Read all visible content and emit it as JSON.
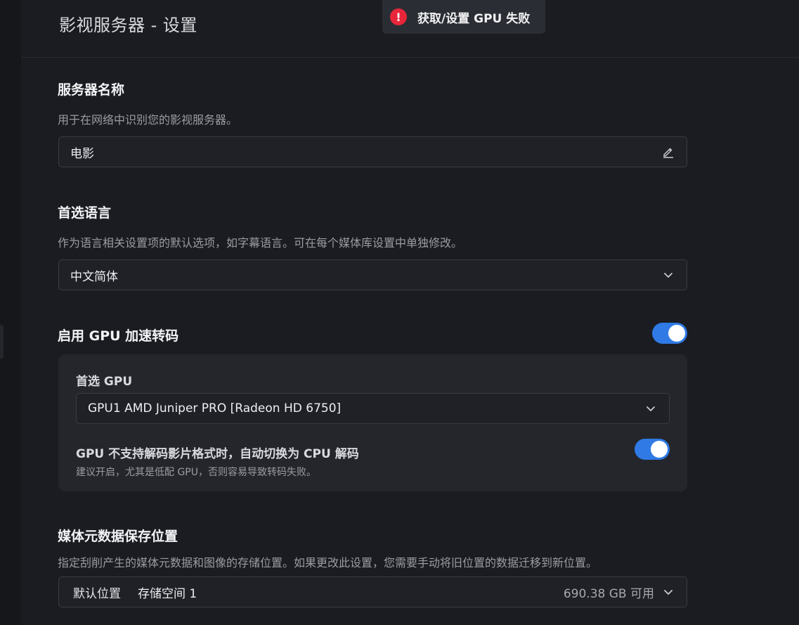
{
  "header": {
    "title": "影视服务器 - 设置"
  },
  "toast": {
    "icon": "error-icon",
    "icon_glyph": "!",
    "message": "获取/设置 GPU 失败"
  },
  "server_name": {
    "title": "服务器名称",
    "description": "用于在网络中识别您的影视服务器。",
    "value": "电影",
    "icon": "edit-icon"
  },
  "language": {
    "title": "首选语言",
    "description": "作为语言相关设置项的默认选项，如字幕语言。可在每个媒体库设置中单独修改。",
    "selected": "中文简体",
    "icon": "chevron-down-icon"
  },
  "gpu": {
    "title": "启用 GPU 加速转码",
    "enabled": true,
    "preferred_label": "首选 GPU",
    "selected_gpu": "GPU1 AMD Juniper PRO [Radeon HD 6750]",
    "fallback_label": "GPU 不支持解码影片格式时，自动切换为 CPU 解码",
    "fallback_enabled": true,
    "fallback_desc": "建议开启，尤其是低配 GPU，否则容易导致转码失败。"
  },
  "metadata": {
    "title": "媒体元数据保存位置",
    "description": "指定刮削产生的媒体元数据和图像的存储位置。如果更改此设置，您需要手动将旧位置的数据迁移到新位置。",
    "tag": "默认位置",
    "location": "存储空间 1",
    "free": "690.38 GB 可用"
  },
  "colors": {
    "accent": "#2f7ae5",
    "error": "#e8263a",
    "background": "#1a1c21"
  }
}
